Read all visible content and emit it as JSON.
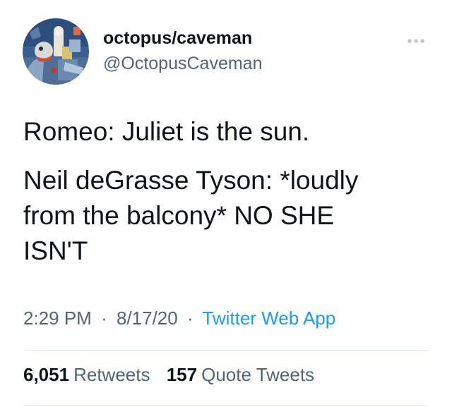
{
  "author": {
    "display_name": "octopus/caveman",
    "handle": "@OctopusCaveman",
    "avatar_icon": "painted-portrait-avatar"
  },
  "more_icon": "more-dots-icon",
  "tweet": {
    "lines": [
      "Romeo: Juliet is the sun.",
      "Neil deGrasse Tyson: *loudly",
      "from the balcony* NO SHE",
      "ISN'T"
    ]
  },
  "meta": {
    "time": "2:29 PM",
    "separator": "·",
    "date": "8/17/20",
    "source": "Twitter Web App"
  },
  "stats": {
    "retweets_count": "6,051",
    "retweets_label": "Retweets",
    "quotes_count": "157",
    "quotes_label": "Quote Tweets"
  },
  "colors": {
    "text_primary": "#0f1419",
    "text_secondary": "#536471",
    "link": "#1d9bf0",
    "divider": "#e1e8ed"
  }
}
